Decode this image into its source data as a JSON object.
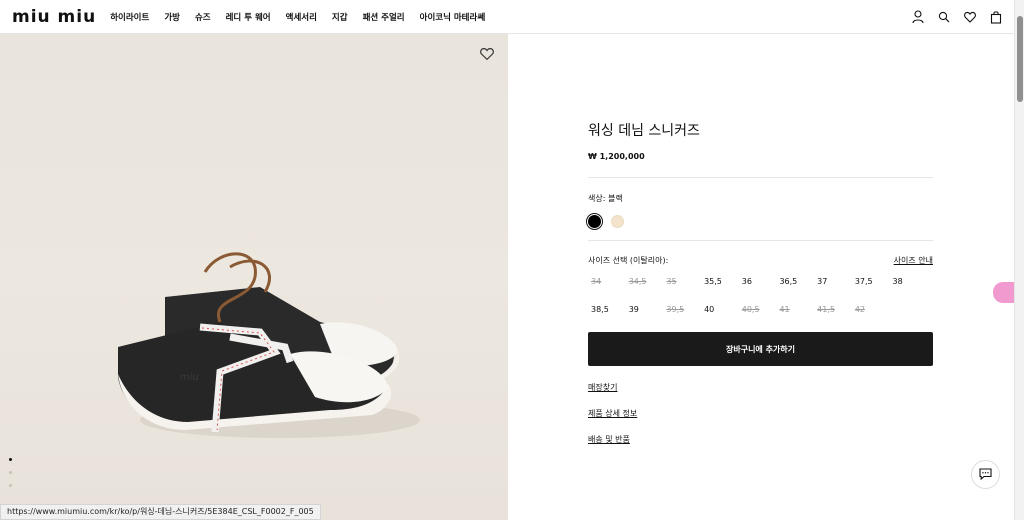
{
  "header": {
    "logo": "miu miu",
    "nav": [
      "하이라이트",
      "가방",
      "슈즈",
      "레디 투 웨어",
      "액세서리",
      "지갑",
      "패션 주얼리",
      "아이코닉 마테라쎄"
    ],
    "icons": [
      "user-icon",
      "search-icon",
      "heart-icon",
      "bag-icon"
    ]
  },
  "product": {
    "title": "워싱 데님 스니커즈",
    "price": "₩ 1,200,000",
    "color_label": "색상:  블랙",
    "colors": [
      "#000000",
      "#f3e3cc"
    ],
    "size_label": "사이즈 선택 (이탈리아):",
    "size_guide": "사이즈 안내",
    "sizes": [
      {
        "label": "34",
        "available": false
      },
      {
        "label": "34,5",
        "available": false
      },
      {
        "label": "35",
        "available": false
      },
      {
        "label": "35,5",
        "available": true
      },
      {
        "label": "36",
        "available": true
      },
      {
        "label": "36,5",
        "available": true
      },
      {
        "label": "37",
        "available": true
      },
      {
        "label": "37,5",
        "available": true
      },
      {
        "label": "38",
        "available": true
      },
      {
        "label": "38,5",
        "available": true
      },
      {
        "label": "39",
        "available": true
      },
      {
        "label": "39,5",
        "available": false
      },
      {
        "label": "40",
        "available": true
      },
      {
        "label": "40,5",
        "available": false
      },
      {
        "label": "41",
        "available": false
      },
      {
        "label": "41,5",
        "available": false
      },
      {
        "label": "42",
        "available": false
      }
    ],
    "add_to_cart": "장바구니에 추가하기",
    "links": [
      "매장찾기",
      "제품 상세 정보",
      "배송 및 반품"
    ]
  },
  "status_url": "https://www.miumiu.com/kr/ko/p/워싱-데님-스니커즈/5E384E_CSL_F0002_F_005"
}
